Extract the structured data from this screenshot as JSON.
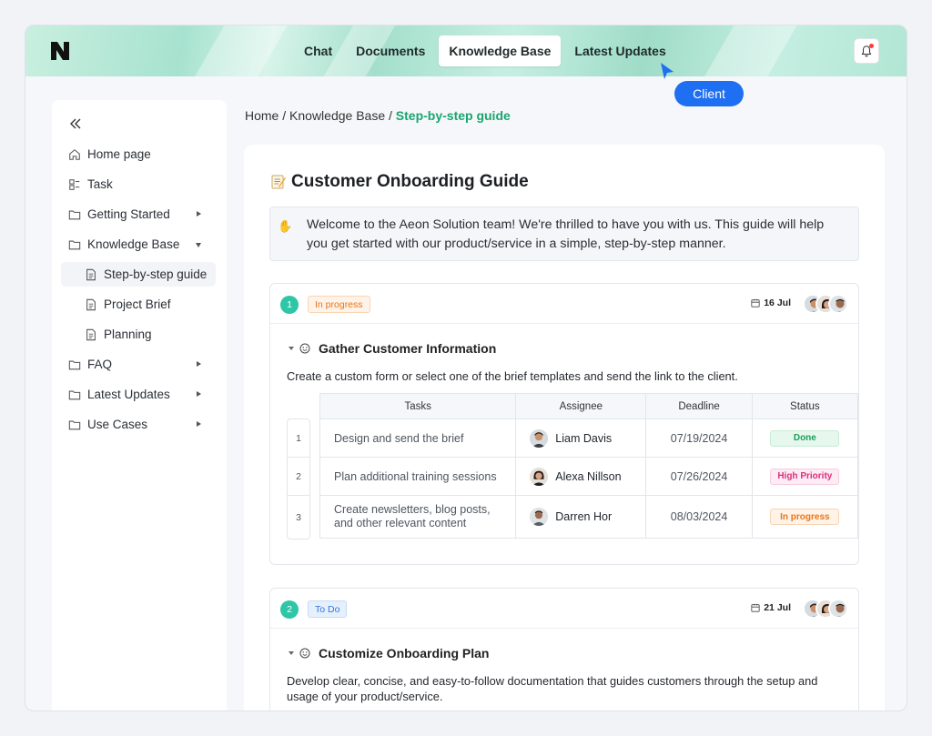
{
  "header": {
    "nav": [
      "Chat",
      "Documents",
      "Knowledge Base",
      "Latest Updates"
    ],
    "active_nav": "Knowledge Base",
    "client_label": "Client"
  },
  "sidebar": {
    "items": [
      {
        "label": "Home page",
        "icon": "home-icon"
      },
      {
        "label": "Task",
        "icon": "task-icon"
      },
      {
        "label": "Getting Started",
        "icon": "folder-icon"
      },
      {
        "label": "Knowledge Base",
        "icon": "folder-icon"
      },
      {
        "label": "Step-by-step guide",
        "icon": "document-icon"
      },
      {
        "label": "Project Brief",
        "icon": "document-icon"
      },
      {
        "label": "Planning",
        "icon": "document-icon"
      },
      {
        "label": "FAQ",
        "icon": "folder-icon"
      },
      {
        "label": "Latest Updates",
        "icon": "folder-icon"
      },
      {
        "label": "Use Cases",
        "icon": "folder-icon"
      }
    ]
  },
  "breadcrumb": {
    "home": "Home",
    "sep": "/",
    "section": "Knowledge Base",
    "current": "Step-by-step guide"
  },
  "doc": {
    "title": "Customer Onboarding Guide",
    "welcome": "Welcome to the Aeon Solution team! We're thrilled to have you with us. This guide will help you get started with our product/service in a simple, step-by-step manner."
  },
  "steps": [
    {
      "num": "1",
      "status": "In progress",
      "date": "16 Jul",
      "title": "Gather Customer Information",
      "description": "Create a custom form or select one of the brief templates and send the link to the client.",
      "table": {
        "headers": [
          "Tasks",
          "Assignee",
          "Deadline",
          "Status"
        ],
        "rows": [
          {
            "n": "1",
            "task": "Design and send the brief",
            "assignee": "Liam Davis",
            "deadline": "07/19/2024",
            "status": "Done"
          },
          {
            "n": "2",
            "task": "Plan additional training sessions",
            "assignee": "Alexa Nillson",
            "deadline": "07/26/2024",
            "status": "High Priority"
          },
          {
            "n": "3",
            "task": "Create newsletters, blog posts, and other relevant content",
            "assignee": "Darren Hor",
            "deadline": "08/03/2024",
            "status": "In progress"
          }
        ]
      }
    },
    {
      "num": "2",
      "status": "To Do",
      "date": "21 Jul",
      "title": "Customize Onboarding Plan",
      "description": "Develop clear, concise, and easy-to-follow documentation that guides customers through the setup and usage of your product/service."
    }
  ],
  "colors": {
    "accent": "#1aa56e",
    "client_tag": "#1e6ff2",
    "step_number": "#2ec6a6"
  }
}
